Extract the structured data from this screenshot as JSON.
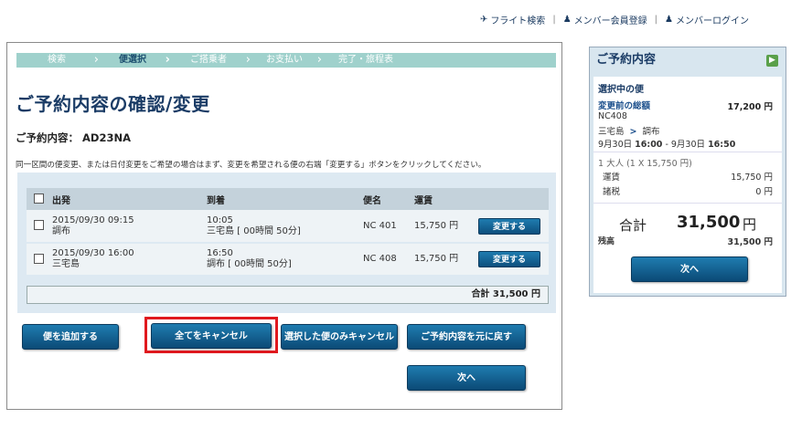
{
  "topnav": {
    "flight_search": "フライト検索",
    "member_register": "メンバー会員登録",
    "member_login": "メンバーログイン"
  },
  "steps": [
    "検索",
    "便選択",
    "ご搭乗者",
    "お支払い",
    "完了・旅程表"
  ],
  "page_title": "ご予約内容の確認/変更",
  "reservation": {
    "label": "ご予約内容：",
    "code": "AD23NA"
  },
  "instruction": "同一区間の便変更、または日付変更をご希望の場合はまず、変更を希望される便の右端「変更する」ボタンをクリックしてください。",
  "table": {
    "headers": [
      "出発",
      "到着",
      "便名",
      "運賃"
    ],
    "rows": [
      {
        "dep_time": "2015/09/30 09:15",
        "dep_place": "調布",
        "arr_time": "10:05",
        "arr_detail": "三宅島 [ 00時間 50分]",
        "flight": "NC 401",
        "fare": "15,750 円",
        "button": "変更する"
      },
      {
        "dep_time": "2015/09/30 16:00",
        "dep_place": "三宅島",
        "arr_time": "16:50",
        "arr_detail": "調布 [ 00時間 50分]",
        "flight": "NC 408",
        "fare": "15,750 円",
        "button": "変更する"
      }
    ],
    "total": "合計 31,500 円"
  },
  "actions": {
    "add_flight": "便を追加する",
    "cancel_all": "全てをキャンセル",
    "cancel_selected": "選択した便のみキャンセル",
    "restore": "ご予約内容を元に戻す",
    "next": "次へ"
  },
  "summary": {
    "title": "ご予約内容",
    "selected_flight": "選択中の便",
    "prev_total_label": "変更前の総額",
    "prev_total_value": "17,200 円",
    "flight_no": "NC408",
    "route_from": "三宅島",
    "route_arrow": ">",
    "route_to": "調布",
    "schedule_dep_date": "9月30日",
    "schedule_dep_time": "16:00",
    "schedule_sep": " - ",
    "schedule_arr_date": "9月30日",
    "schedule_arr_time": "16:50",
    "pax": "1 大人 (1 X 15,750 円)",
    "fare_label": "運賃",
    "fare_value": "15,750 円",
    "tax_label": "諸税",
    "tax_value": "0 円",
    "total_label": "合計",
    "total_value": "31,500",
    "total_unit": "円",
    "balance_label": "残高",
    "balance_value": "31,500 円",
    "next": "次へ"
  }
}
